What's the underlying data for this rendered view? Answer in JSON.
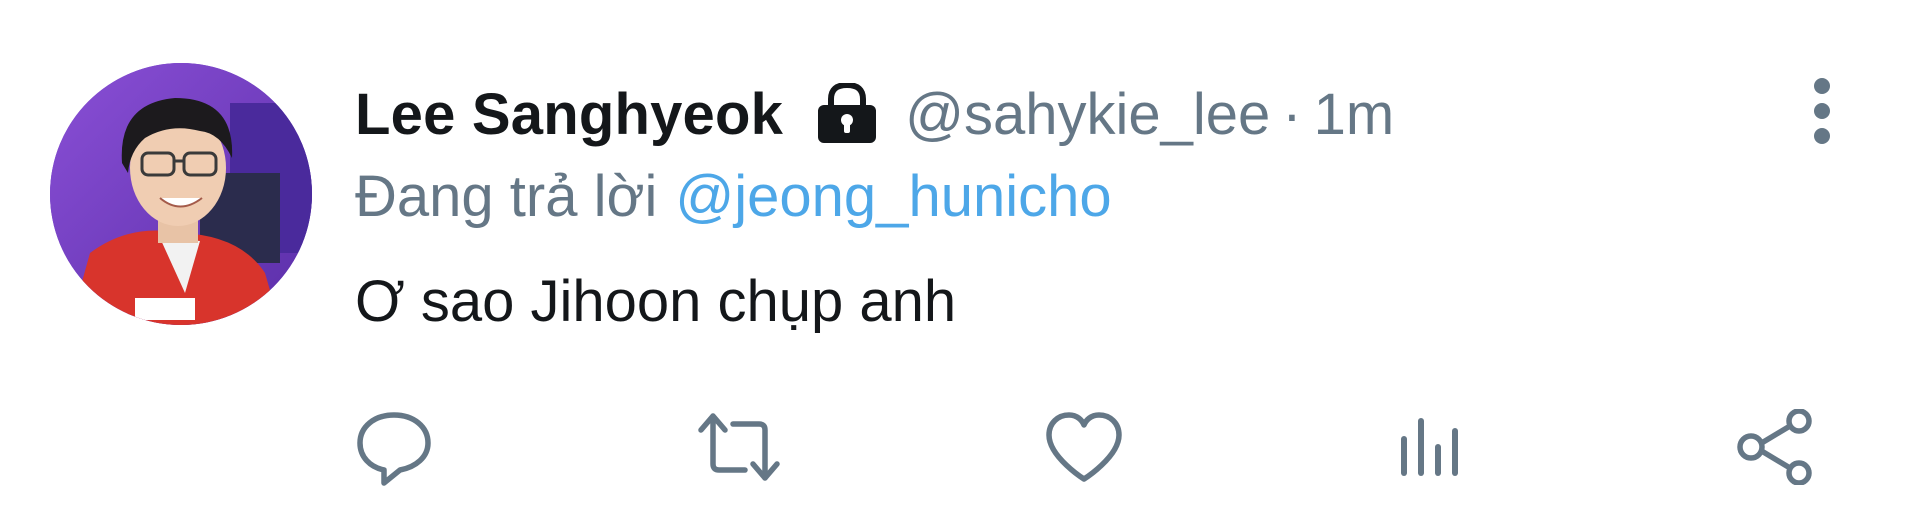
{
  "tweet": {
    "display_name": "Lee Sanghyeok",
    "handle": "@sahykie_lee",
    "separator": "·",
    "time": "1m",
    "reply_prefix": "Đang trả lời",
    "reply_to": "@jeong_hunicho",
    "text": "Ơ sao Jihoon chụp anh",
    "icons": {
      "protected": "lock-icon",
      "more": "more-vertical-icon",
      "reply": "comment-icon",
      "retweet": "retweet-icon",
      "like": "heart-icon",
      "analytics": "bar-chart-icon",
      "share": "share-icon"
    }
  },
  "colors": {
    "text_primary": "#14171a",
    "text_secondary": "#657786",
    "link": "#4da7e8",
    "icon_gray": "#657786"
  }
}
